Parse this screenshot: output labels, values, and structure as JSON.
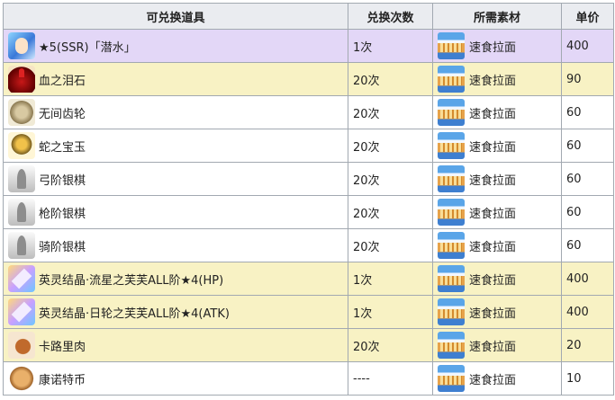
{
  "headers": {
    "item": "可兑换道具",
    "count": "兑换次数",
    "material": "所需素材",
    "price": "单价"
  },
  "rows": [
    {
      "icon": "ssr-servant-swimsuit-icon",
      "name": "★5(SSR)「潜水」",
      "count": "1次",
      "material": "速食拉面",
      "price": "400",
      "highlight": "purple"
    },
    {
      "icon": "blood-tear-stone-icon",
      "name": "血之泪石",
      "count": "20次",
      "material": "速食拉面",
      "price": "90",
      "highlight": "yellow"
    },
    {
      "icon": "eternal-gear-icon",
      "name": "无间齿轮",
      "count": "20次",
      "material": "速食拉面",
      "price": "60",
      "highlight": "none"
    },
    {
      "icon": "serpent-jewel-icon",
      "name": "蛇之宝玉",
      "count": "20次",
      "material": "速食拉面",
      "price": "60",
      "highlight": "none"
    },
    {
      "icon": "archer-silver-piece-icon",
      "name": "弓阶银棋",
      "count": "20次",
      "material": "速食拉面",
      "price": "60",
      "highlight": "none"
    },
    {
      "icon": "lancer-silver-piece-icon",
      "name": "枪阶银棋",
      "count": "20次",
      "material": "速食拉面",
      "price": "60",
      "highlight": "none"
    },
    {
      "icon": "rider-silver-piece-icon",
      "name": "骑阶银棋",
      "count": "20次",
      "material": "速食拉面",
      "price": "60",
      "highlight": "none"
    },
    {
      "icon": "fou-crystal-hp-icon",
      "name": "英灵结晶·流星之芙芙ALL阶★4(HP)",
      "count": "1次",
      "material": "速食拉面",
      "price": "400",
      "highlight": "yellow"
    },
    {
      "icon": "fou-crystal-atk-icon",
      "name": "英灵结晶·日轮之芙芙ALL阶★4(ATK)",
      "count": "1次",
      "material": "速食拉面",
      "price": "400",
      "highlight": "yellow"
    },
    {
      "icon": "kalbi-meat-icon",
      "name": "卡路里肉",
      "count": "20次",
      "material": "速食拉面",
      "price": "20",
      "highlight": "yellow"
    },
    {
      "icon": "connoisseur-coin-icon",
      "name": "康诺特币",
      "count": "----",
      "material": "速食拉面",
      "price": "10",
      "highlight": "none"
    }
  ],
  "colors": {
    "header_bg": "#eaecf0",
    "purple_row": "#e3d7f7",
    "yellow_row": "#f8f2c4",
    "border": "#a2a9b1"
  }
}
